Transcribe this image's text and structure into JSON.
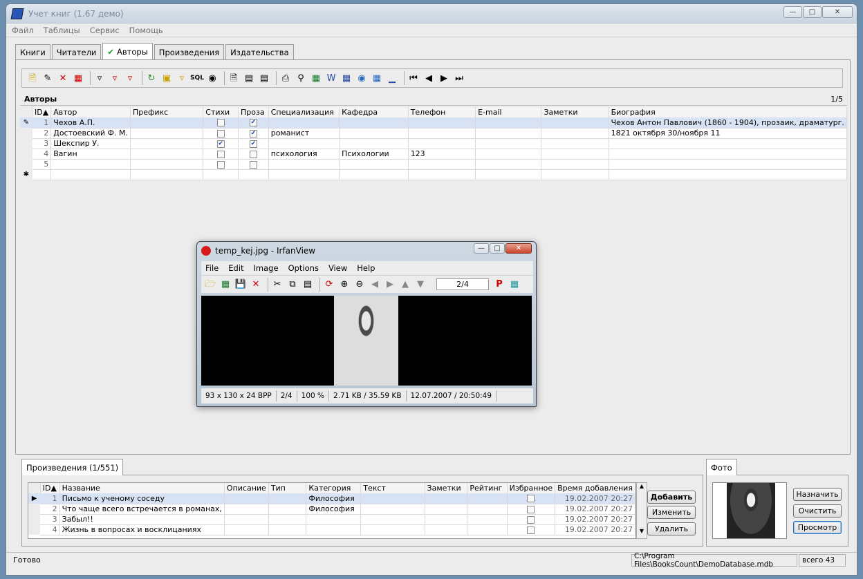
{
  "window": {
    "title": "Учет книг (1.67 демо)"
  },
  "menu": [
    "Файл",
    "Таблицы",
    "Сервис",
    "Помощь"
  ],
  "tabs": [
    {
      "label": "Книги",
      "active": false
    },
    {
      "label": "Читатели",
      "active": false
    },
    {
      "label": "Авторы",
      "active": true
    },
    {
      "label": "Произведения",
      "active": false
    },
    {
      "label": "Издательства",
      "active": false
    }
  ],
  "authors": {
    "title": "Авторы",
    "counter": "1/5",
    "columns": [
      "ID",
      "Автор",
      "Префикс",
      "Стихи",
      "Проза",
      "Специализация",
      "Кафедра",
      "Телефон",
      "E-mail",
      "Заметки",
      "Биография"
    ],
    "rows": [
      {
        "id": "1",
        "author": "Чехов А.П.",
        "prefix": "",
        "poems": false,
        "prose": true,
        "spec": "",
        "dept": "",
        "phone": "",
        "email": "",
        "notes": "",
        "bio": "Чехов Антон Павлович (1860 - 1904), прозаик, драматург."
      },
      {
        "id": "2",
        "author": "Достоевский Ф. М.",
        "prefix": "",
        "poems": false,
        "prose": true,
        "spec": "романист",
        "dept": "",
        "phone": "",
        "email": "",
        "notes": "",
        "bio": "1821 октября 30/ноября 11"
      },
      {
        "id": "3",
        "author": "Шекспир У.",
        "prefix": "",
        "poems": true,
        "prose": true,
        "spec": "",
        "dept": "",
        "phone": "",
        "email": "",
        "notes": "",
        "bio": ""
      },
      {
        "id": "4",
        "author": "Вагин",
        "prefix": "",
        "poems": false,
        "prose": false,
        "spec": "психология",
        "dept": "Психологии",
        "phone": "123",
        "email": "",
        "notes": "",
        "bio": ""
      },
      {
        "id": "5",
        "author": "",
        "prefix": "",
        "poems": false,
        "prose": false,
        "spec": "",
        "dept": "",
        "phone": "",
        "email": "",
        "notes": "",
        "bio": ""
      }
    ]
  },
  "works": {
    "tab": "Произведения (1/551)",
    "columns": [
      "ID",
      "Название",
      "Описание",
      "Тип",
      "Категория",
      "Текст",
      "Заметки",
      "Рейтинг",
      "Избранное",
      "Время добавления"
    ],
    "rows": [
      {
        "id": "1",
        "name": "Письмо к ученому соседу",
        "category": "Философия",
        "time": "19.02.2007 20:27"
      },
      {
        "id": "2",
        "name": "Что чаще всего встречается в романах,",
        "category": "Философия",
        "time": "19.02.2007 20:27"
      },
      {
        "id": "3",
        "name": "Забыл!!",
        "category": "",
        "time": "19.02.2007 20:27"
      },
      {
        "id": "4",
        "name": "Жизнь в вопросах и восклицаниях",
        "category": "",
        "time": "19.02.2007 20:27"
      }
    ],
    "buttons": {
      "add": "Добавить",
      "edit": "Изменить",
      "delete": "Удалить"
    }
  },
  "photo": {
    "tab": "Фото",
    "buttons": {
      "assign": "Назначить",
      "clear": "Очистить",
      "view": "Просмотр"
    }
  },
  "status": {
    "left": "Готово",
    "path": "C:\\Program Files\\BooksCount\\DemoDatabase.mdb",
    "total": "всего 43"
  },
  "irfan": {
    "title": "temp_kej.jpg - IrfanView",
    "menu": [
      "File",
      "Edit",
      "Image",
      "Options",
      "View",
      "Help"
    ],
    "page": "2/4",
    "status": [
      "93 x 130 x 24 BPP",
      "2/4",
      "100 %",
      "2.71 KB / 35.59 KB",
      "12.07.2007 / 20:50:49"
    ]
  }
}
